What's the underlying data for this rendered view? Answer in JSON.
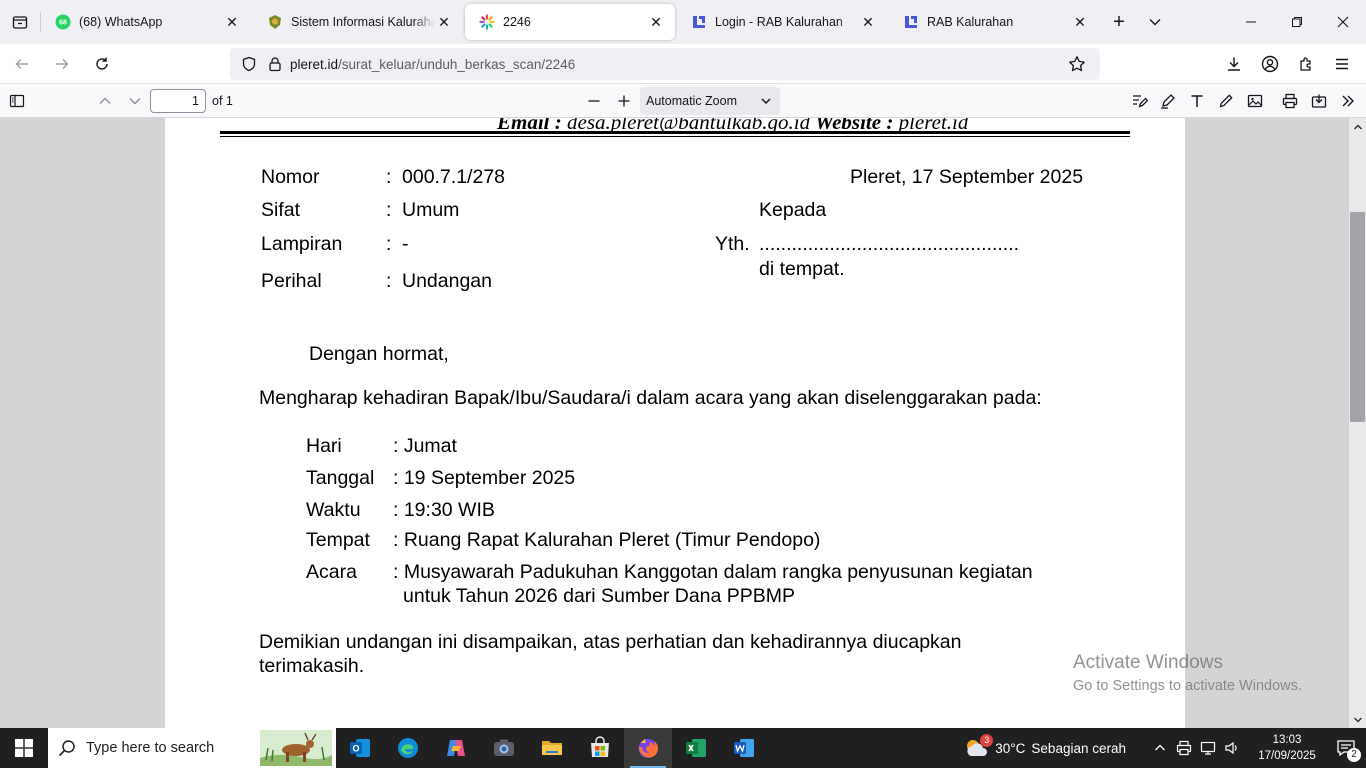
{
  "browser": {
    "tabs": [
      {
        "title": "(68) WhatsApp",
        "badge": "68",
        "active": false
      },
      {
        "title": "Sistem Informasi Kalurahan Pleret",
        "active": false
      },
      {
        "title": "2246",
        "active": true
      },
      {
        "title": "Login - RAB Kalurahan",
        "active": false
      },
      {
        "title": "RAB Kalurahan",
        "active": false
      }
    ],
    "url": {
      "host": "pleret.id",
      "path": "/surat_keluar/unduh_berkas_scan/2246"
    }
  },
  "pdf_toolbar": {
    "page_number": "1",
    "page_count": "of 1",
    "zoom": "Automatic Zoom"
  },
  "letter": {
    "header_email_label": "Email :",
    "header_email": "desa.pleret@bantulkab.go.id",
    "header_website_label": "Website :",
    "header_website": "pleret.id",
    "meta": [
      {
        "label": "Nomor",
        "sep": ":",
        "value": "000.7.1/278"
      },
      {
        "label": "Sifat",
        "sep": ":",
        "value": "Umum"
      },
      {
        "label": "Lampiran",
        "sep": ":",
        "value": "-"
      },
      {
        "label": "Perihal",
        "sep": ":",
        "value": "Undangan"
      }
    ],
    "place_date": "Pleret, 17 September 2025",
    "kepada": "Kepada",
    "yth": "Yth.",
    "recipient_dots": "................................................",
    "di_tempat": "di tempat.",
    "greeting": "Dengan hormat,",
    "intro": "Mengharap kehadiran Bapak/Ibu/Saudara/i dalam acara yang akan diselenggarakan pada:",
    "details": [
      {
        "label": "Hari",
        "value": ": Jumat"
      },
      {
        "label": "Tanggal",
        "value": ": 19 September 2025"
      },
      {
        "label": "Waktu",
        "value": ": 19:30 WIB"
      },
      {
        "label": "Tempat",
        "value": ": Ruang Rapat Kalurahan Pleret (Timur Pendopo)"
      },
      {
        "label": "Acara",
        "value": ": Musyawarah Padukuhan Kanggotan dalam rangka penyusunan kegiatan",
        "value2": "untuk Tahun 2026 dari Sumber Dana PPBMP"
      }
    ],
    "closing_line1": "Demikian undangan ini disampaikan, atas perhatian dan kehadirannya diucapkan",
    "closing_line2": "terimakasih."
  },
  "watermark": {
    "line1": "Activate Windows",
    "line2": "Go to Settings to activate Windows."
  },
  "taskbar": {
    "search_placeholder": "Type here to search",
    "weather_badge": "3",
    "weather_temp": "30°C",
    "weather_desc": "Sebagian cerah",
    "time": "13:03",
    "date": "17/09/2025",
    "notification_count": "2"
  },
  "colors": {
    "accent": "#0061e0",
    "whatsapp": "#25d366",
    "rab_icon": "#4a57d6",
    "taskbar": "#202020"
  }
}
